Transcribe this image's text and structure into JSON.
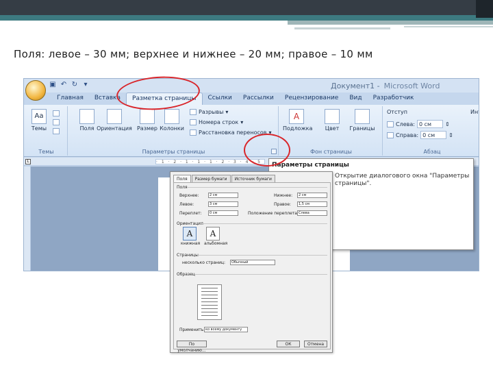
{
  "slide": {
    "title": "Поля: левое – 30 мм; верхнее и нижнее – 20 мм; правое – 10 мм"
  },
  "window": {
    "doc_title": "Документ1",
    "app_name": "Microsoft Word"
  },
  "quick_access": {
    "save_icon": "save-icon",
    "undo_icon": "undo-icon",
    "redo_icon": "redo-icon"
  },
  "tabs": [
    "Главная",
    "Вставка",
    "Разметка страницы",
    "Ссылки",
    "Рассылки",
    "Рецензирование",
    "Вид",
    "Разработчик"
  ],
  "ribbon": {
    "themes_group": {
      "label": "Темы",
      "themes_btn": "Темы"
    },
    "page_setup_group": {
      "label": "Параметры страницы",
      "margins": "Поля",
      "orientation": "Ориентация",
      "size": "Размер",
      "columns": "Колонки",
      "breaks": "Разрывы",
      "line_numbers": "Номера строк",
      "hyphenation": "Расстановка переносов"
    },
    "background_group": {
      "label": "Фон страницы",
      "watermark": "Подложка",
      "page_color": "Цвет",
      "page_borders": "Границы"
    },
    "paragraph_group": {
      "label": "Абзац",
      "indent": "Отступ",
      "left": "Слева:",
      "left_val": "0 см",
      "right": "Справа:",
      "right_val": "0 см",
      "spacing": "Инт"
    }
  },
  "tooltip": {
    "title": "Параметры страницы",
    "text": "Открытие диалогового окна \"Параметры страницы\"."
  },
  "dialog": {
    "tabs": [
      "Поля",
      "Размер бумаги",
      "Источник бумаги"
    ],
    "margins_section": "Поля",
    "top_label": "Верхнее:",
    "top_val": "2 см",
    "bottom_label": "Нижнее:",
    "bottom_val": "2 см",
    "left_label": "Левое:",
    "left_val": "3 см",
    "right_label": "Правое:",
    "right_val": "1,5 см",
    "gutter_label": "Переплет:",
    "gutter_val": "0 см",
    "gutter_pos_label": "Положение переплета:",
    "gutter_pos_val": "Слева",
    "orientation_section": "Ориентация",
    "portrait": "книжная",
    "landscape": "альбомная",
    "pages_section": "Страницы",
    "multiple_pages_label": "несколько страниц:",
    "multiple_pages_val": "Обычный",
    "sample_section": "Образец",
    "apply_label": "Применить:",
    "apply_val": "ко всему документу",
    "default_btn": "По умолчанию...",
    "ok_btn": "ОК",
    "cancel_btn": "Отмена"
  }
}
